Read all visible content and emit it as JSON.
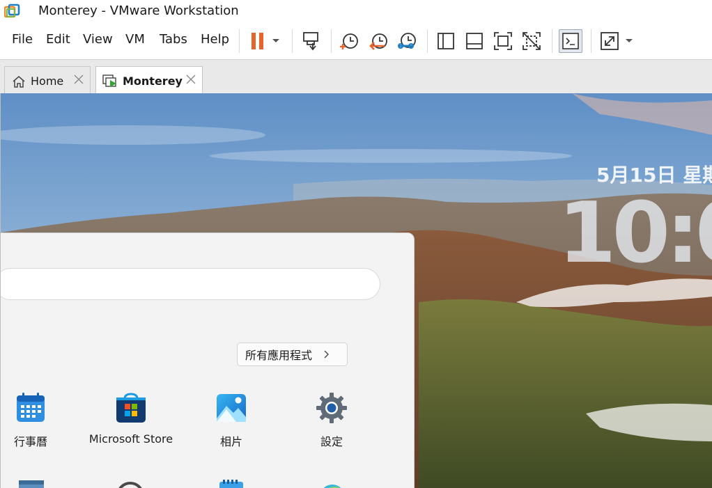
{
  "window": {
    "title": "Monterey - VMware Workstation"
  },
  "menu": {
    "items": [
      "File",
      "Edit",
      "View",
      "VM",
      "Tabs",
      "Help"
    ]
  },
  "toolbar": {
    "buttons": [
      "pause-icon",
      "dropdown-arrow-icon",
      "send-ctrl-alt-del-icon",
      "snapshot-take-icon",
      "snapshot-revert-icon",
      "snapshot-manager-icon",
      "library-sidebar-icon",
      "thumbnail-bar-icon",
      "full-screen-icon",
      "unity-icon",
      "console-view-icon",
      "stretch-guest-icon"
    ],
    "accent": "#e8622c"
  },
  "tabs": [
    {
      "label": "Home",
      "icon": "home-icon",
      "selected": false
    },
    {
      "label": "Monterey",
      "icon": "vm-running-icon",
      "selected": true
    }
  ],
  "lockscreen": {
    "date": "5月15日 星期",
    "time": "10:0"
  },
  "start_menu": {
    "all_apps_label": "所有應用程式",
    "pinned": [
      {
        "label": "行事曆",
        "icon": "calendar-icon"
      },
      {
        "label": "Microsoft Store",
        "icon": "microsoft-store-icon"
      },
      {
        "label": "相片",
        "icon": "photos-icon"
      },
      {
        "label": "設定",
        "icon": "settings-gear-icon"
      }
    ]
  }
}
